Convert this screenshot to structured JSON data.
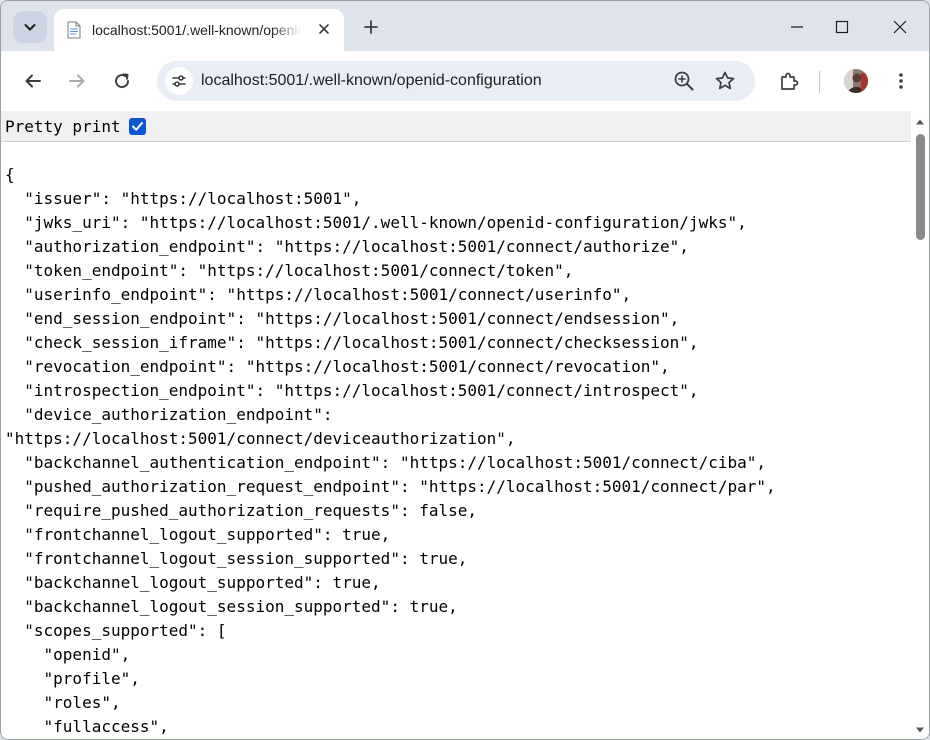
{
  "tab": {
    "title": "localhost:5001/.well-known/openid-configuration",
    "close_glyph": "✕",
    "new_tab_glyph": "+"
  },
  "window_controls": {
    "minimize": "—",
    "maximize": "☐",
    "close": "✕"
  },
  "toolbar": {
    "url": "localhost:5001/.well-known/openid-configuration"
  },
  "pretty_print": {
    "label": "Pretty print",
    "checked": true
  },
  "json_lines": [
    "{",
    "  \"issuer\": \"https://localhost:5001\",",
    "  \"jwks_uri\": \"https://localhost:5001/.well-known/openid-configuration/jwks\",",
    "  \"authorization_endpoint\": \"https://localhost:5001/connect/authorize\",",
    "  \"token_endpoint\": \"https://localhost:5001/connect/token\",",
    "  \"userinfo_endpoint\": \"https://localhost:5001/connect/userinfo\",",
    "  \"end_session_endpoint\": \"https://localhost:5001/connect/endsession\",",
    "  \"check_session_iframe\": \"https://localhost:5001/connect/checksession\",",
    "  \"revocation_endpoint\": \"https://localhost:5001/connect/revocation\",",
    "  \"introspection_endpoint\": \"https://localhost:5001/connect/introspect\",",
    "  \"device_authorization_endpoint\":",
    "\"https://localhost:5001/connect/deviceauthorization\",",
    "  \"backchannel_authentication_endpoint\": \"https://localhost:5001/connect/ciba\",",
    "  \"pushed_authorization_request_endpoint\": \"https://localhost:5001/connect/par\",",
    "  \"require_pushed_authorization_requests\": false,",
    "  \"frontchannel_logout_supported\": true,",
    "  \"frontchannel_logout_session_supported\": true,",
    "  \"backchannel_logout_supported\": true,",
    "  \"backchannel_logout_session_supported\": true,",
    "  \"scopes_supported\": [",
    "    \"openid\",",
    "    \"profile\",",
    "    \"roles\",",
    "    \"fullaccess\","
  ],
  "colors": {
    "accent": "#0b57d0",
    "omnibox": "#e9edf5",
    "chrome": "#dfe3eb"
  }
}
